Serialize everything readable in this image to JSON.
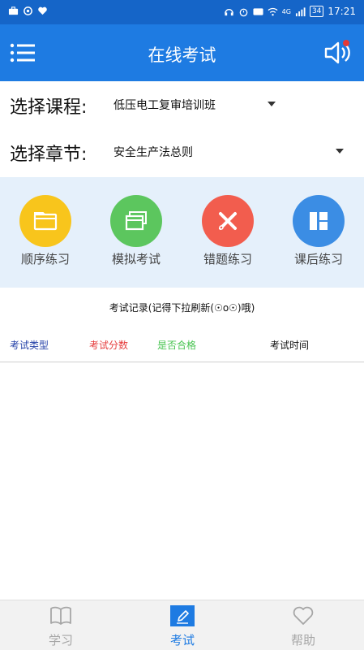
{
  "status_bar": {
    "network_label": "4G",
    "battery": "34",
    "time": "17:21"
  },
  "header": {
    "title": "在线考试"
  },
  "selectors": {
    "course": {
      "label": "选择课程:",
      "value": "低压电工复审培训班"
    },
    "chapter": {
      "label": "选择章节:",
      "value": "安全生产法总则"
    }
  },
  "tiles": [
    {
      "label": "顺序练习",
      "icon": "folder-icon",
      "color": "#f8c51c"
    },
    {
      "label": "模拟考试",
      "icon": "stack-icon",
      "color": "#5cc65e"
    },
    {
      "label": "错题练习",
      "icon": "cross-icon",
      "color": "#f25d4e"
    },
    {
      "label": "课后练习",
      "icon": "grid-icon",
      "color": "#3b8de4"
    }
  ],
  "records": {
    "title": "考试记录(记得下拉刷新(☉o☉)哦)",
    "columns": {
      "type": "考试类型",
      "score": "考试分数",
      "pass": "是否合格",
      "time": "考试时间"
    }
  },
  "bottom_nav": {
    "items": [
      {
        "label": "学习",
        "icon": "book-icon",
        "active": false
      },
      {
        "label": "考试",
        "icon": "edit-icon",
        "active": true
      },
      {
        "label": "帮助",
        "icon": "heart-icon",
        "active": false
      }
    ]
  },
  "colors": {
    "status_bar": "#1565c8",
    "header": "#1e7be2",
    "tiles_background": "#e5f0fb",
    "active_nav": "#1e7be2"
  }
}
